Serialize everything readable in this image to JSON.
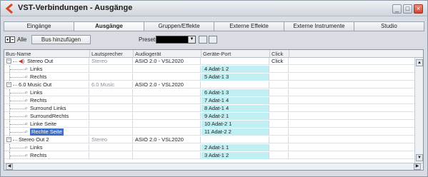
{
  "window": {
    "title": "VST-Verbindungen - Ausgänge",
    "min_glyph": "_",
    "max_glyph": "□",
    "close_glyph": "×"
  },
  "tabs": [
    {
      "label": "Eingänge",
      "active": false
    },
    {
      "label": "Ausgänge",
      "active": true
    },
    {
      "label": "Gruppen/Effekte",
      "active": false
    },
    {
      "label": "Externe Effekte",
      "active": false
    },
    {
      "label": "Externe Instrumente",
      "active": false
    },
    {
      "label": "Studio",
      "active": false
    }
  ],
  "toolbar": {
    "all_label": "Alle",
    "add_bus_label": "Bus hinzufügen",
    "presets_label": "Presets",
    "presets_value": ""
  },
  "columns": {
    "bus_name": "Bus-Name",
    "speaker": "Lautsprecher",
    "device": "Audiogerät",
    "port": "Geräte-Port",
    "click": "Click"
  },
  "rows": [
    {
      "name": "Stereo Out",
      "level": 0,
      "expandable": true,
      "speaker": "Stereo",
      "device": "ASIO 2.0 - VSL2020",
      "port": "",
      "click": "Click",
      "icon": "speaker-icon",
      "selected": false
    },
    {
      "name": "Links",
      "level": 1,
      "expandable": false,
      "speaker": "",
      "device": "",
      "port": "4 Adat-1 2",
      "click": "",
      "selected": false
    },
    {
      "name": "Rechts",
      "level": 1,
      "expandable": false,
      "speaker": "",
      "device": "",
      "port": "5 Adat-1 3",
      "click": "",
      "selected": false
    },
    {
      "name": "6.0 Music Out",
      "level": 0,
      "expandable": true,
      "speaker": "6.0 Music",
      "device": "ASIO 2.0 - VSL2020",
      "port": "",
      "click": "",
      "selected": false
    },
    {
      "name": "Links",
      "level": 1,
      "expandable": false,
      "speaker": "",
      "device": "",
      "port": "6 Adat-1 3",
      "click": "",
      "selected": false
    },
    {
      "name": "Rechts",
      "level": 1,
      "expandable": false,
      "speaker": "",
      "device": "",
      "port": "7 Adat-1 4",
      "click": "",
      "selected": false
    },
    {
      "name": "Surround Links",
      "level": 1,
      "expandable": false,
      "speaker": "",
      "device": "",
      "port": "8 Adat-1 4",
      "click": "",
      "selected": false
    },
    {
      "name": "SurroundRechts",
      "level": 1,
      "expandable": false,
      "speaker": "",
      "device": "",
      "port": "9 Adat-2 1",
      "click": "",
      "selected": false
    },
    {
      "name": "Linke Seite",
      "level": 1,
      "expandable": false,
      "speaker": "",
      "device": "",
      "port": "10 Adat-2 1",
      "click": "",
      "selected": false
    },
    {
      "name": "Rechte Seite",
      "level": 1,
      "expandable": false,
      "speaker": "",
      "device": "",
      "port": "11 Adat-2 2",
      "click": "",
      "selected": true
    },
    {
      "name": "Stereo Out 2",
      "level": 0,
      "expandable": true,
      "speaker": "Stereo",
      "device": "ASIO 2.0 - VSL2020",
      "port": "",
      "click": "",
      "selected": false
    },
    {
      "name": "Links",
      "level": 1,
      "expandable": false,
      "speaker": "",
      "device": "",
      "port": "2 Adat-1 1",
      "click": "",
      "selected": false
    },
    {
      "name": "Rechts",
      "level": 1,
      "expandable": false,
      "speaker": "",
      "device": "",
      "port": "3 Adat-1 2",
      "click": "",
      "selected": false
    }
  ],
  "colors": {
    "port_highlight": "#bfeef3",
    "selection": "#3f6fc6",
    "close_button": "#d1452f"
  }
}
